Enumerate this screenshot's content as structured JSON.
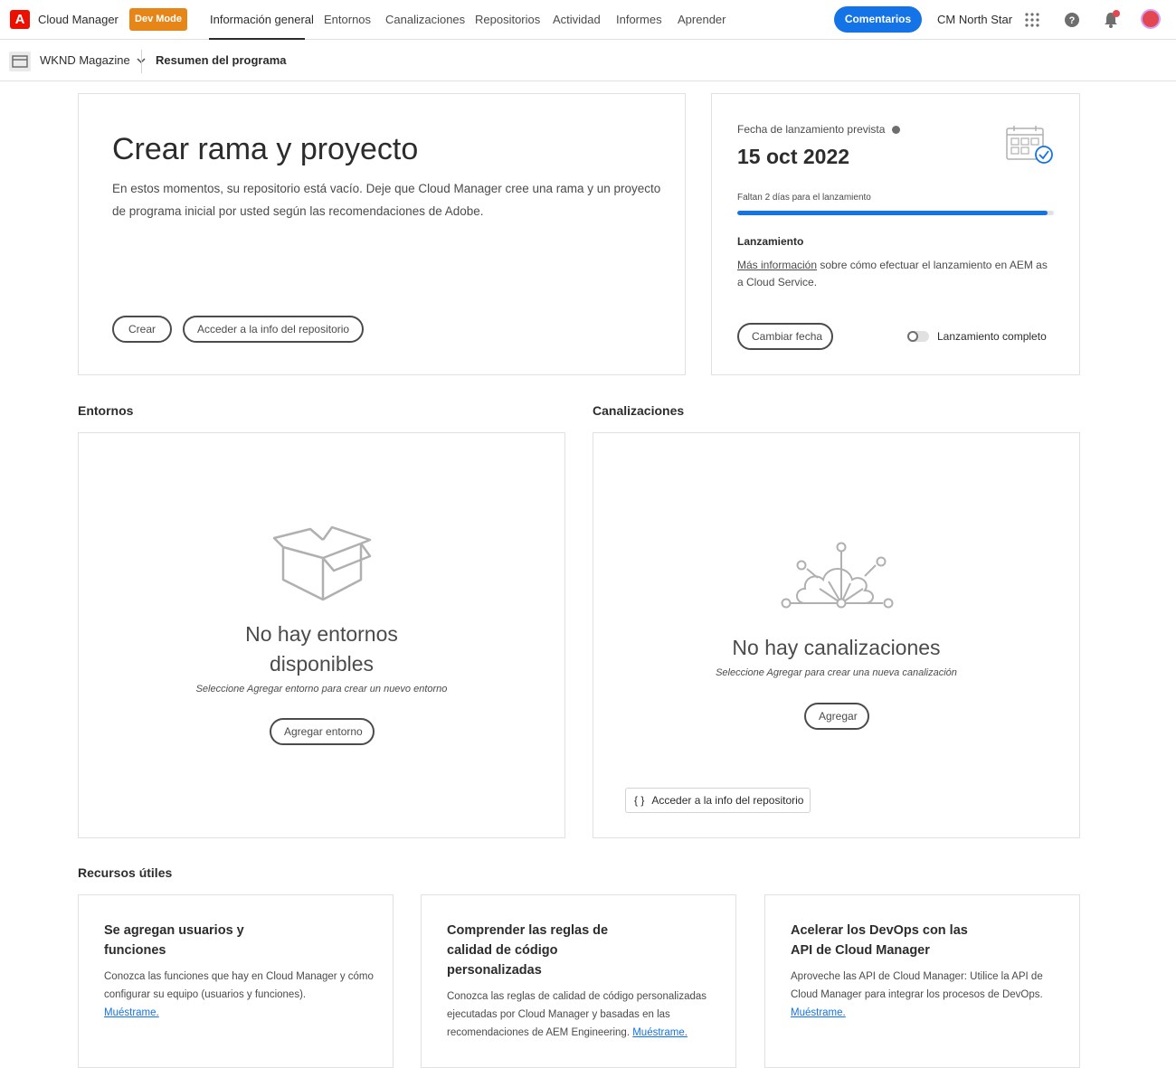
{
  "topnav": {
    "logo_letter": "A",
    "app_name": "Cloud Manager",
    "dev_mode": "Dev Mode",
    "links": [
      "Información general",
      "Entornos",
      "Canalizaciones",
      "Repositorios",
      "Actividad",
      "Informes",
      "Aprender"
    ],
    "feedback": "Comentarios",
    "org": "CM North Star",
    "icons": [
      "apps-grid-icon",
      "help-icon",
      "bell-icon",
      "avatar"
    ],
    "accent": "#1473e6",
    "dev_mode_color": "#e68619",
    "brand_color": "#eb1000"
  },
  "subheader": {
    "program": "WKND Magazine",
    "summary": "Resumen del programa"
  },
  "hero": {
    "title": "Crear rama y proyecto",
    "description": "En estos momentos, su repositorio está vacío. Deje que Cloud Manager cree una rama y un proyecto de programa inicial por usted según las recomendaciones de Adobe.",
    "btn_create": "Crear",
    "btn_repo": "Acceder a la info del repositorio"
  },
  "launch": {
    "label": "Fecha de lanzamiento prevista",
    "date": "15 oct 2022",
    "remaining": "Faltan 2 días para el lanzamiento",
    "progress": 0.98,
    "heading": "Lanzamiento",
    "link": "Más información",
    "text": " sobre cómo efectuar el lanzamiento en AEM as a Cloud Service.",
    "btn_change": "Cambiar fecha",
    "toggle_label": "Lanzamiento completo",
    "toggle_on": false
  },
  "environments": {
    "section": "Entornos",
    "empty_title_1": "No hay entornos",
    "empty_title_2": "disponibles",
    "empty_sub": "Seleccione Agregar entorno para crear un nuevo entorno",
    "btn_add": "Agregar entorno"
  },
  "pipelines": {
    "section": "Canalizaciones",
    "empty_title": "No hay canalizaciones",
    "empty_sub": "Seleccione Agregar para crear una nueva canalización",
    "btn_add": "Agregar",
    "repo_icon": "{ }",
    "repo_link": "Acceder a la info del repositorio"
  },
  "resources": {
    "section": "Recursos útiles",
    "cards": [
      {
        "title": "Se agregan usuarios y funciones",
        "text": "Conozca las funciones que hay en Cloud Manager y cómo configurar su equipo (usuarios y funciones).",
        "link": "Muéstrame."
      },
      {
        "title": "Comprender las reglas de calidad de código personalizadas",
        "text": "Conozca las reglas de calidad de código personalizadas ejecutadas por Cloud Manager y basadas en las recomendaciones de AEM Engineering.",
        "link": "Muéstrame."
      },
      {
        "title": "Acelerar los DevOps con las API de Cloud Manager",
        "text": "Aproveche las API de Cloud Manager: Utilice la API de Cloud Manager para integrar los procesos de DevOps.",
        "link": "Muéstrame."
      }
    ]
  }
}
